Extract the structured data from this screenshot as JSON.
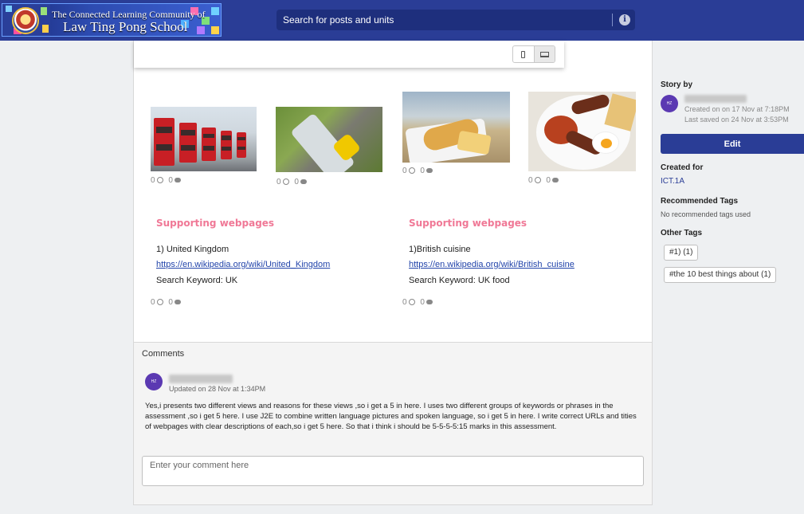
{
  "header": {
    "logo_line1": "The Connected Learning Community of",
    "logo_line2": "Law Ting Pong School",
    "search_placeholder": "Search for posts and units"
  },
  "device_toggle": {
    "options": [
      "phone-icon",
      "laptop-icon"
    ]
  },
  "images": [
    {
      "likes": "0",
      "comments": "0"
    },
    {
      "likes": "0",
      "comments": "0"
    },
    {
      "likes": "0",
      "comments": "0"
    },
    {
      "likes": "0",
      "comments": "0"
    }
  ],
  "webpages": [
    {
      "heading": "Supporting webpages",
      "title": "1) United Kingdom",
      "url": "https://en.wikipedia.org/wiki/United_Kingdom",
      "keyword": "Search Keyword: UK",
      "likes": "0",
      "comments": "0"
    },
    {
      "heading": "Supporting webpages",
      "title": "1)British cuisine",
      "url": "https://en.wikipedia.org/wiki/British_cuisine",
      "keyword": "Search Keyword: UK food",
      "likes": "0",
      "comments": "0"
    }
  ],
  "comments": {
    "title": "Comments",
    "items": [
      {
        "avatar_initials": "HZ",
        "updated": "Updated on 28 Nov at 1:34PM",
        "text": "Yes,i presents two different views and reasons for these views ,so i get a 5 in here. I uses two different groups of keywords or phrases in the assessment ,so i get 5 here. I use J2E to combine written language pictures and spoken language, so i get 5 in here. I write correct URLs and tities of webpages with clear descriptions of each,so i get 5 here. So that i think i should be 5-5-5-5:15 marks in this assessment."
      }
    ],
    "input_placeholder": "Enter your comment here"
  },
  "sidebar": {
    "story_by_label": "Story by",
    "author_initials": "HZ",
    "created_on": "Created on on 17 Nov at 7:18PM",
    "last_saved": "Last saved on 24 Nov at 3:53PM",
    "edit_label": "Edit",
    "created_for_label": "Created for",
    "created_for_value": "ICT.1A",
    "recommended_tags_label": "Recommended Tags",
    "recommended_tags_text": "No recommended tags used",
    "other_tags_label": "Other Tags",
    "tags": [
      "#1) (1)",
      "#the 10 best things about (1)"
    ]
  }
}
